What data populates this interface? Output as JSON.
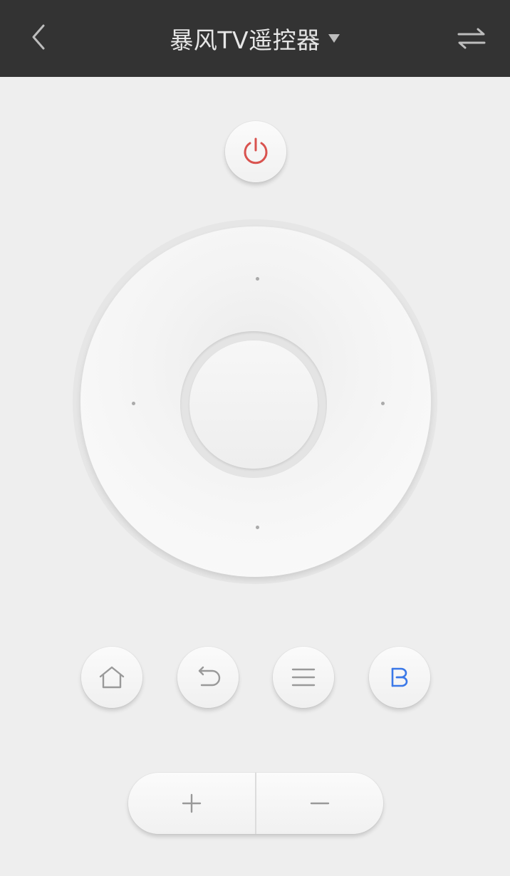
{
  "header": {
    "title": "暴风TV遥控器",
    "back_icon": "chevron-left-icon",
    "dropdown_icon": "caret-down-icon",
    "switch_icon": "swap-arrows-icon",
    "background_color": "#333333"
  },
  "power": {
    "icon": "power-icon",
    "icon_color": "#d9534f"
  },
  "dpad": {
    "up_icon": "dot-icon",
    "down_icon": "dot-icon",
    "left_icon": "dot-icon",
    "right_icon": "dot-icon"
  },
  "function_buttons": [
    {
      "icon": "home-icon"
    },
    {
      "icon": "return-icon"
    },
    {
      "icon": "menu-icon"
    },
    {
      "icon": "storm-logo-icon",
      "icon_color": "#3a78e8"
    }
  ],
  "volume": {
    "up_label": "+",
    "down_label": "−"
  }
}
